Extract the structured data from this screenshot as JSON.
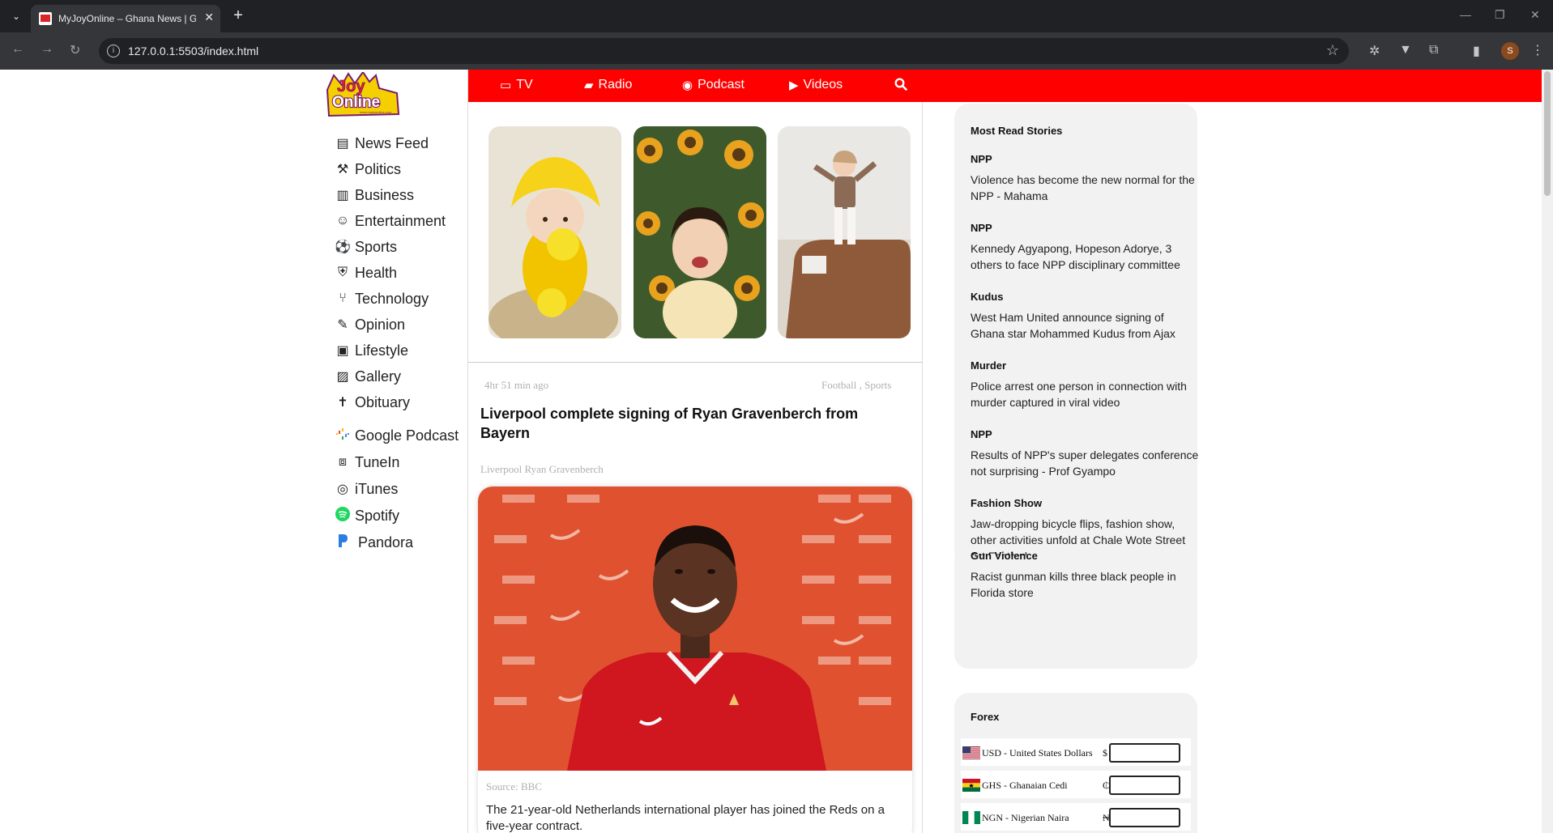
{
  "browser": {
    "tab_title": "MyJoyOnline – Ghana News | G",
    "url": "127.0.0.1:5503/index.html",
    "profile_initial": "S"
  },
  "logo": {
    "line1": "Joy",
    "line2": "Online",
    "site": "www.myjoyonline.com"
  },
  "sidebar": {
    "items": [
      {
        "label": "News Feed",
        "icon": "newspaper-icon"
      },
      {
        "label": "Politics",
        "icon": "gavel-icon"
      },
      {
        "label": "Business",
        "icon": "building-icon"
      },
      {
        "label": "Entertainment",
        "icon": "smile-icon"
      },
      {
        "label": "Sports",
        "icon": "soccer-ball-icon"
      },
      {
        "label": "Health",
        "icon": "medkit-icon"
      },
      {
        "label": "Technology",
        "icon": "code-branch-icon"
      },
      {
        "label": "Opinion",
        "icon": "paint-brush-icon"
      },
      {
        "label": "Lifestyle",
        "icon": "suitcase-icon"
      },
      {
        "label": "Gallery",
        "icon": "image-icon"
      },
      {
        "label": "Obituary",
        "icon": "cross-icon"
      }
    ],
    "podcast_links": [
      {
        "label": "Google Podcast",
        "icon": "google-podcasts-icon"
      },
      {
        "label": "TuneIn",
        "icon": "tunein-icon"
      },
      {
        "label": "iTunes",
        "icon": "podcast-icon"
      },
      {
        "label": "Spotify",
        "icon": "spotify-icon"
      },
      {
        "label": "Pandora",
        "icon": "pandora-icon"
      }
    ]
  },
  "topnav": {
    "items": [
      {
        "label": "TV",
        "icon": "tv-icon"
      },
      {
        "label": "Radio",
        "icon": "radio-icon"
      },
      {
        "label": "Podcast",
        "icon": "podcast-icon"
      },
      {
        "label": "Videos",
        "icon": "play-circle-icon"
      }
    ],
    "search_icon": "search-icon"
  },
  "article": {
    "time": "4hr 51 min ago",
    "categories": "Football , Sports",
    "title": "Liverpool complete signing of Ryan Gravenberch from Bayern",
    "tags": "Liverpool  Ryan Gravenberch",
    "source": "Source: BBC",
    "summary": "The 21-year-old Netherlands international player has joined the Reds on a five-year contract."
  },
  "most_read": {
    "title": "Most Read Stories",
    "stories": [
      {
        "category": "NPP",
        "headline": "Violence has become the new normal for the NPP - Mahama"
      },
      {
        "category": "NPP",
        "headline": "Kennedy Agyapong, Hopeson Adorye, 3 others to face NPP disciplinary committee"
      },
      {
        "category": "Kudus",
        "headline": "West Ham United announce signing of Ghana star Mohammed Kudus from Ajax"
      },
      {
        "category": "Murder",
        "headline": "Police arrest one person in connection with murder captured in viral video"
      },
      {
        "category": "NPP",
        "headline": "Results of NPP's super delegates conference not surprising - Prof Gyampo"
      },
      {
        "category": "Fashion Show",
        "headline": "Jaw-dropping bicycle flips, fashion show, other activities unfold at Chale Wote Street Art Festival"
      },
      {
        "category": "Gun Violence",
        "headline": "Racist gunman kills three black people in Florida store"
      }
    ]
  },
  "forex": {
    "title": "Forex",
    "rows": [
      {
        "label": "USD - United States Dollars",
        "symbol": "$",
        "value": ""
      },
      {
        "label": "GHS - Ghanaian Cedi",
        "symbol": "₵",
        "value": ""
      },
      {
        "label": "NGN - Nigerian Naira",
        "symbol": "₦",
        "value": ""
      }
    ]
  },
  "colors": {
    "brand_red": "#ff0000",
    "panel_bg": "#f2f2f2"
  }
}
